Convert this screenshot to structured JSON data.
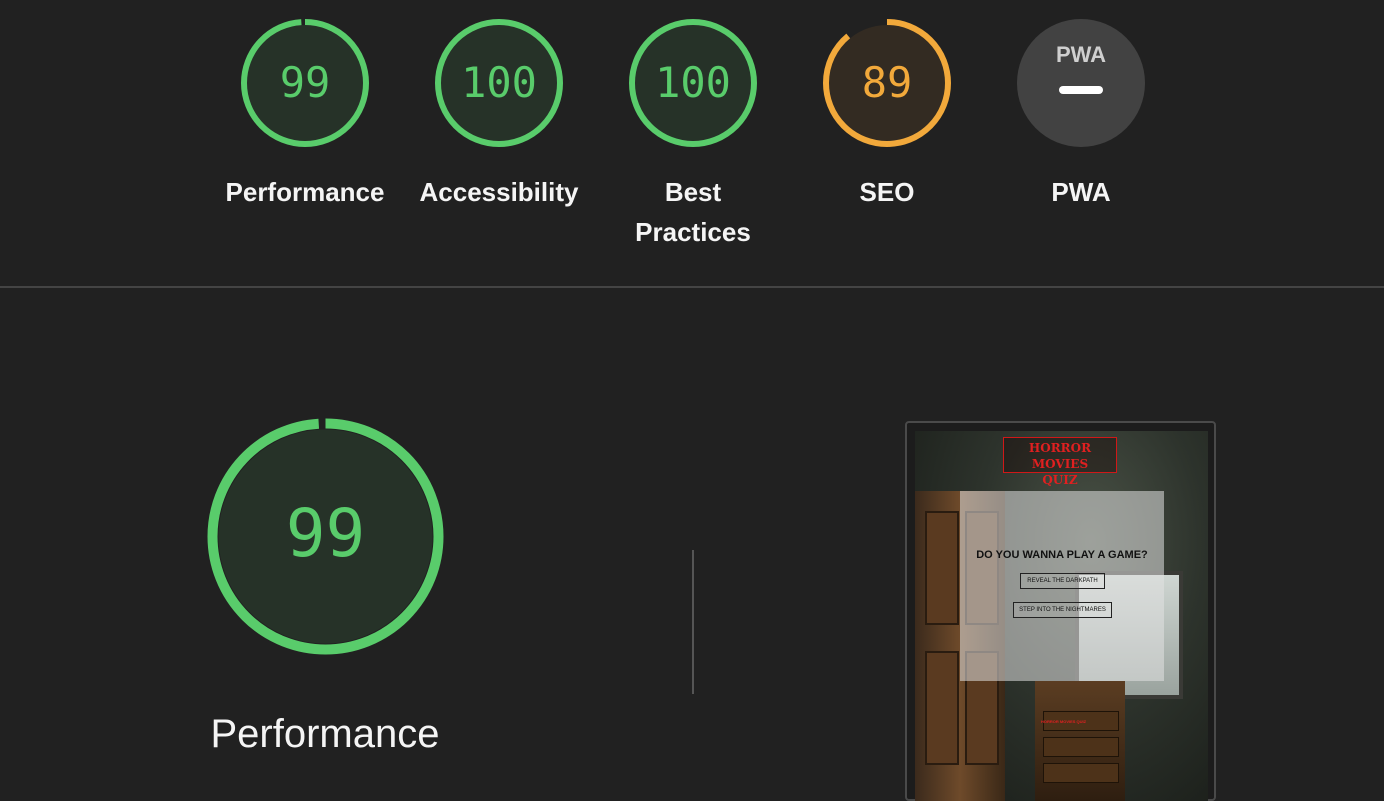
{
  "colors": {
    "pass": "#0cce6b",
    "pass_ring": "#59cc6b",
    "pass_fill": "#263228",
    "average": "#ffa400",
    "average_ring": "#f2a93b",
    "average_fill": "#332b22",
    "pwa_fill": "#424242"
  },
  "categories": [
    {
      "id": "performance",
      "label": "Performance",
      "score": "99",
      "value": 99,
      "status": "pass"
    },
    {
      "id": "accessibility",
      "label": "Accessibility",
      "score": "100",
      "value": 100,
      "status": "pass"
    },
    {
      "id": "best-practices",
      "label_line1": "Best",
      "label_line2": "Practices",
      "score": "100",
      "value": 100,
      "status": "pass"
    },
    {
      "id": "seo",
      "label": "SEO",
      "score": "89",
      "value": 89,
      "status": "average"
    },
    {
      "id": "pwa",
      "label": "PWA",
      "badge_text": "PWA",
      "status": "na"
    }
  ],
  "performance_section": {
    "score": "99",
    "value": 99,
    "label": "Performance"
  },
  "screenshot": {
    "title_line1": "HORROR MOVIES",
    "title_line2": "QUIZ",
    "question": "DO YOU WANNA PLAY A GAME?",
    "button1": "REVEAL THE DARKPATH",
    "button2": "STEP INTO THE NIGHTMARES",
    "footer": "HORROR MOVIES QUIZ"
  }
}
